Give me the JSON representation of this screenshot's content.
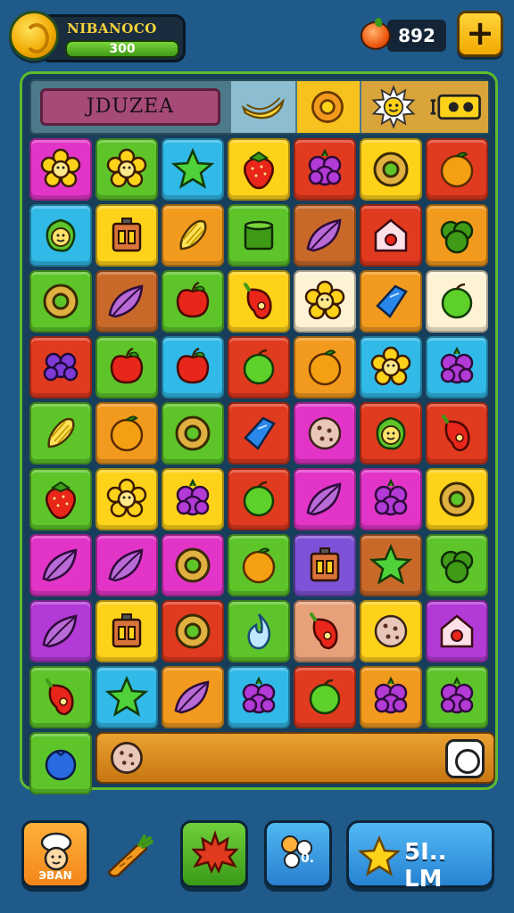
{
  "hud": {
    "player_name": "NIBANOCO",
    "player_score": "300",
    "gem_count": "892",
    "add_label": "+"
  },
  "board": {
    "title": "JDUZEA",
    "grid": [
      [
        {
          "icon": "flower",
          "bg": "#e235c8"
        },
        {
          "icon": "flower",
          "bg": "#5dc52a"
        },
        {
          "icon": "star",
          "bg": "#31b9e8"
        },
        {
          "icon": "strawberry",
          "bg": "#ffd21a"
        },
        {
          "icon": "berry",
          "bg": "#e03a1f"
        },
        {
          "icon": "donut",
          "bg": "#ffd21a"
        },
        {
          "icon": "orange",
          "bg": "#e03a1f"
        }
      ],
      [
        {
          "icon": "face-leaf",
          "bg": "#31b9e8"
        },
        {
          "icon": "box",
          "bg": "#ffd21a"
        },
        {
          "icon": "corn",
          "bg": "#f29a1e"
        },
        {
          "icon": "cup",
          "bg": "#5dc52a"
        },
        {
          "icon": "leaf",
          "bg": "#c8692a"
        },
        {
          "icon": "house",
          "bg": "#e03a1f"
        },
        {
          "icon": "lettuce",
          "bg": "#f29a1e"
        }
      ],
      [
        {
          "icon": "donut",
          "bg": "#5dc52a"
        },
        {
          "icon": "leaf",
          "bg": "#c8692a"
        },
        {
          "icon": "apple",
          "bg": "#5dc52a"
        },
        {
          "icon": "pepper",
          "bg": "#ffd21a"
        },
        {
          "icon": "flower",
          "bg": "#fff3d6"
        },
        {
          "icon": "gem",
          "bg": "#f29a1e"
        },
        {
          "icon": "lime",
          "bg": "#fff3d6"
        }
      ],
      [
        {
          "icon": "grape",
          "bg": "#e03a1f"
        },
        {
          "icon": "apple",
          "bg": "#5dc52a"
        },
        {
          "icon": "apple",
          "bg": "#31b9e8"
        },
        {
          "icon": "lime",
          "bg": "#e03a1f"
        },
        {
          "icon": "orange",
          "bg": "#f29a1e"
        },
        {
          "icon": "flower",
          "bg": "#31b9e8"
        },
        {
          "icon": "berry",
          "bg": "#31b9e8"
        }
      ],
      [
        {
          "icon": "corn",
          "bg": "#5dc52a"
        },
        {
          "icon": "orange",
          "bg": "#f29a1e"
        },
        {
          "icon": "donut",
          "bg": "#5dc52a"
        },
        {
          "icon": "gem",
          "bg": "#e03a1f"
        },
        {
          "icon": "cookie",
          "bg": "#e235c8"
        },
        {
          "icon": "face-leaf",
          "bg": "#e03a1f"
        },
        {
          "icon": "pepper",
          "bg": "#e03a1f"
        }
      ],
      [
        {
          "icon": "strawberry",
          "bg": "#5dc52a"
        },
        {
          "icon": "flower",
          "bg": "#ffd21a"
        },
        {
          "icon": "berry",
          "bg": "#ffd21a"
        },
        {
          "icon": "lime",
          "bg": "#e03a1f"
        },
        {
          "icon": "leaf",
          "bg": "#e235c8"
        },
        {
          "icon": "berry",
          "bg": "#e235c8"
        },
        {
          "icon": "donut",
          "bg": "#ffd21a"
        }
      ],
      [
        {
          "icon": "leaf",
          "bg": "#e235c8"
        },
        {
          "icon": "leaf",
          "bg": "#e235c8"
        },
        {
          "icon": "donut",
          "bg": "#e235c8"
        },
        {
          "icon": "orange",
          "bg": "#5dc52a"
        },
        {
          "icon": "box",
          "bg": "#7e52d6"
        },
        {
          "icon": "star",
          "bg": "#c8692a"
        },
        {
          "icon": "lettuce",
          "bg": "#5dc52a"
        }
      ],
      [
        {
          "icon": "leaf",
          "bg": "#b23ad6"
        },
        {
          "icon": "box",
          "bg": "#ffd21a"
        },
        {
          "icon": "donut",
          "bg": "#e03a1f"
        },
        {
          "icon": "flame",
          "bg": "#5dc52a"
        },
        {
          "icon": "pepper",
          "bg": "#e8a07a"
        },
        {
          "icon": "cookie",
          "bg": "#ffd21a"
        },
        {
          "icon": "house",
          "bg": "#b23ad6"
        }
      ],
      [
        {
          "icon": "pepper",
          "bg": "#5dc52a"
        },
        {
          "icon": "star",
          "bg": "#31b9e8"
        },
        {
          "icon": "leaf",
          "bg": "#f29a1e"
        },
        {
          "icon": "berry",
          "bg": "#31b9e8"
        },
        {
          "icon": "lime",
          "bg": "#e03a1f"
        },
        {
          "icon": "berry",
          "bg": "#f29a1e"
        },
        {
          "icon": "berry",
          "bg": "#5dc52a"
        }
      ],
      [
        {
          "icon": "blueberry",
          "bg": "#5dc52a"
        }
      ]
    ],
    "bottom_bar_item": "cookie"
  },
  "toolbar": {
    "chef_label": "ЭBAN",
    "blue_label": "0.",
    "play_label": "5I.. LM"
  }
}
